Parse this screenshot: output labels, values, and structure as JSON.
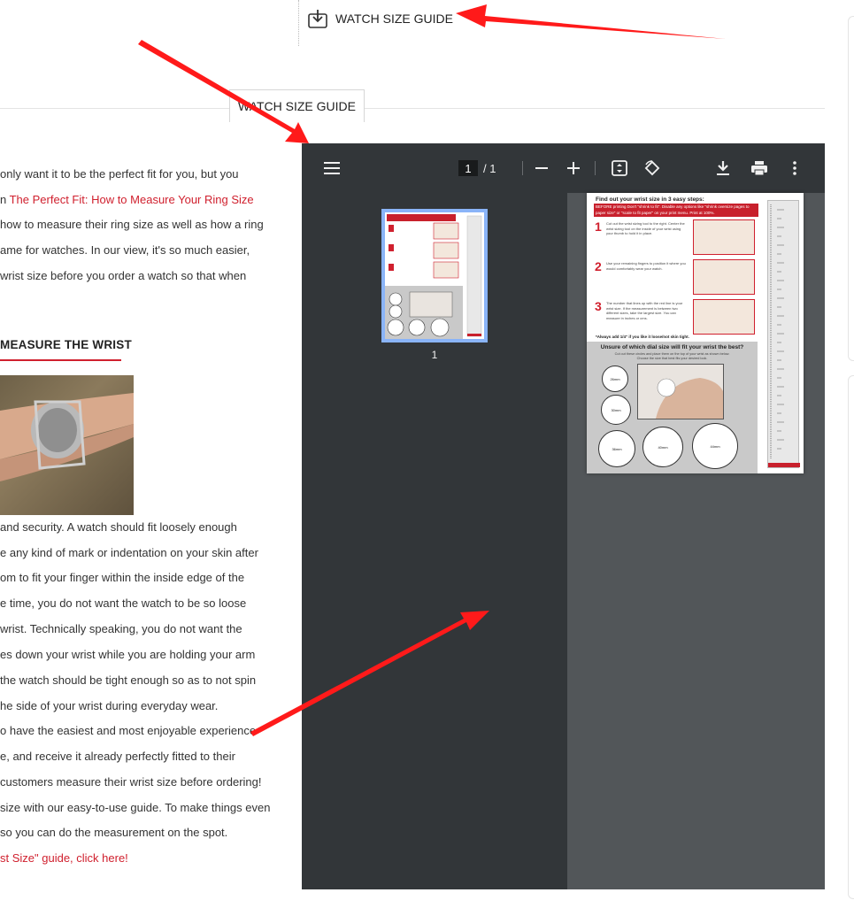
{
  "top_link": {
    "label": "WATCH SIZE GUIDE",
    "icon": "download-box-icon"
  },
  "tab": {
    "label": "WATCH SIZE GUIDE"
  },
  "article": {
    "intro_lines": [
      " only want it to be the perfect fit for you, but you",
      "n ",
      "how to measure their ring size as well as how a ring",
      "ame for watches.  In our view, it's so much easier,",
      "wrist size before you order a watch so that when"
    ],
    "intro_link": "The Perfect Fit: How to Measure Your Ring Size",
    "heading": "MEASURE THE WRIST",
    "body_lines": [
      " and security.  A watch should fit loosely enough",
      "e any kind of mark or indentation on your skin after",
      "om to fit your finger within the inside edge of the",
      "e time, you do not want the watch to be so loose",
      " wrist. Technically speaking, you do not want the",
      "es down your wrist while you are holding your arm",
      " the watch should be tight enough so as to not spin",
      "he side of your wrist during everyday wear.",
      "o have the easiest and most enjoyable experience",
      "e, and receive it already perfectly fitted to their",
      "customers measure their wrist size before ordering!",
      "size with our easy-to-use guide.  To make things even",
      " so you can do the measurement on the spot."
    ],
    "final_link": "st Size\" guide, click here!"
  },
  "pdf_viewer": {
    "current_page": "1",
    "total_pages": "/  1",
    "thumbnail_label": "1",
    "toolbar_icons": [
      "menu-icon",
      "zoom-out-icon",
      "zoom-in-icon",
      "fit-page-icon",
      "rotate-icon",
      "download-icon",
      "print-icon",
      "more-vert-icon"
    ],
    "page": {
      "title": "Find out your wrist size in 3 easy steps:",
      "band_text": "BEFORE printing Don't \"shrink to fit\". Disable any options like \"shrink oversize pages to paper size\" or \"scale to fit paper\" on your print menu. Print at 100%.",
      "steps": [
        {
          "num": "1",
          "text": "Cut out the wrist sizing tool to the right. Center the wrist sizing tool on the inside of your wrist using your thumb to hold it in place."
        },
        {
          "num": "2",
          "text": "Use your remaining fingers to position it where you would comfortably wear your watch."
        },
        {
          "num": "3",
          "text": "The number that lines up with the red line is your wrist size. If the measurement is between two different sizes, take the largest size. You can measure in inches or cms."
        }
      ],
      "note": "*Always add 1/4\" if you like it loose/not skin tight.",
      "dial_title": "Unsure of which dial size will fit your wrist the best?",
      "dial_sub": "Cut out these circles and place them on the top of your wrist as shown below. Choose the size that best fits your desired look.",
      "dials": [
        "26mm",
        "30mm",
        "36mm",
        "40mm",
        "44mm"
      ]
    }
  },
  "colors": {
    "accent_red": "#d0202e",
    "viewer_dark": "#323639",
    "viewer_bg": "#525659",
    "thumb_border": "#8ab4f8",
    "annotation_arrow": "#ff1a1a"
  }
}
